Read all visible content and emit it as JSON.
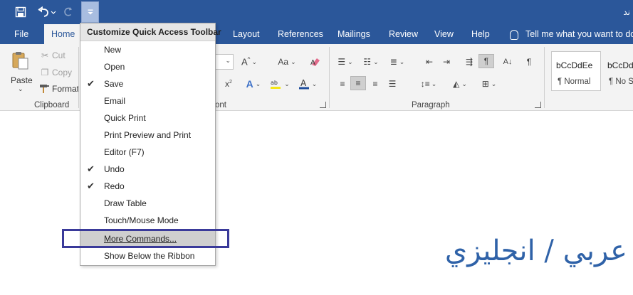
{
  "titlebar": {
    "right_text": "ند",
    "icons": [
      "save-icon",
      "undo-icon",
      "redo-icon",
      "customize-dropdown-icon"
    ]
  },
  "tabs": [
    {
      "label": "File"
    },
    {
      "label": "Home"
    },
    {
      "label": "Layout"
    },
    {
      "label": "References"
    },
    {
      "label": "Mailings"
    },
    {
      "label": "Review"
    },
    {
      "label": "View"
    },
    {
      "label": "Help"
    }
  ],
  "tellme": {
    "text": "Tell me what you want to do"
  },
  "ribbon": {
    "clipboard": {
      "paste": "Paste",
      "cut": "Cut",
      "copy": "Copy",
      "format": "Format",
      "label": "Clipboard"
    },
    "font": {
      "label_fragment": "ont"
    },
    "paragraph": {
      "label": "Paragraph"
    },
    "styles": [
      {
        "sample": "bCcDdEe",
        "name": "¶ Normal"
      },
      {
        "sample": "bCcDd",
        "name": "¶ No Sp"
      }
    ]
  },
  "menu": {
    "header": "Customize Quick Access Toolbar",
    "items": [
      {
        "label": "New",
        "checked": false
      },
      {
        "label": "Open",
        "checked": false
      },
      {
        "label": "Save",
        "checked": true
      },
      {
        "label": "Email",
        "checked": false
      },
      {
        "label": "Quick Print",
        "checked": false
      },
      {
        "label": "Print Preview and Print",
        "checked": false
      },
      {
        "label": "Editor (F7)",
        "checked": false
      },
      {
        "label": "Undo",
        "checked": true
      },
      {
        "label": "Redo",
        "checked": true
      },
      {
        "label": "Draw Table",
        "checked": false
      },
      {
        "label": "Touch/Mouse Mode",
        "checked": false
      },
      {
        "label": "More Commands...",
        "checked": false,
        "highlighted": true
      },
      {
        "label": "Show Below the Ribbon",
        "checked": false
      }
    ]
  },
  "document": {
    "arabic_text": "عربي / انجليزي"
  },
  "colors": {
    "brand": "#2b579a",
    "annotation": "#3a3a9a",
    "arabic_text": "#2f62a8"
  }
}
